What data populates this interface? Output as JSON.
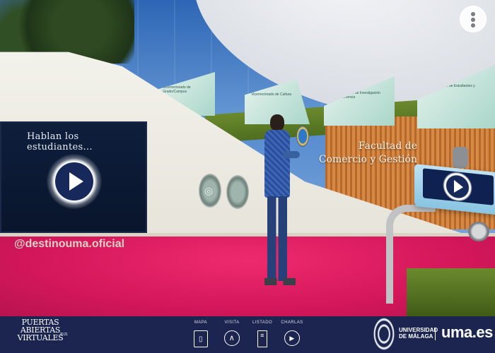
{
  "scene": {
    "video_screen_title": "Hablan los estudiantes...",
    "social_handle": "@destinouma.oficial",
    "faculty_sign": [
      "Facultad de",
      "Comercio y Gestión"
    ],
    "panels": [
      "Vicerrectorado de Grado/Campus",
      "Vicerrectorado de Cultura",
      "Vicerrectorado de Investigación y Transferencia",
      "Vicerrectorado de Estudiantes y Deporte"
    ]
  },
  "top_menu": {
    "icon": "vertical-dots-icon"
  },
  "bottom_bar": {
    "brand_lines": [
      "PUERTAS",
      "ABIERTAS",
      "VIRTUALES"
    ],
    "brand_year": "20 21",
    "nav": [
      {
        "label": "MAPA",
        "icon": "map-icon",
        "glyph": "▯"
      },
      {
        "label": "VISITA",
        "icon": "chevron-up-icon",
        "glyph": "∧"
      },
      {
        "label": "LISTADO",
        "icon": "list-icon",
        "glyph": "≡"
      },
      {
        "label": "CHARLAS",
        "icon": "video-icon",
        "glyph": "▶"
      }
    ],
    "university_lines": [
      "UNIVERSIDAD",
      "DE MÁLAGA"
    ],
    "uma_logo": "uma.es"
  },
  "colors": {
    "bar_bg": "#1b2550",
    "floor": "#d4175a",
    "screen_bg": "#0e1e3c",
    "play_button": "#17295a"
  }
}
